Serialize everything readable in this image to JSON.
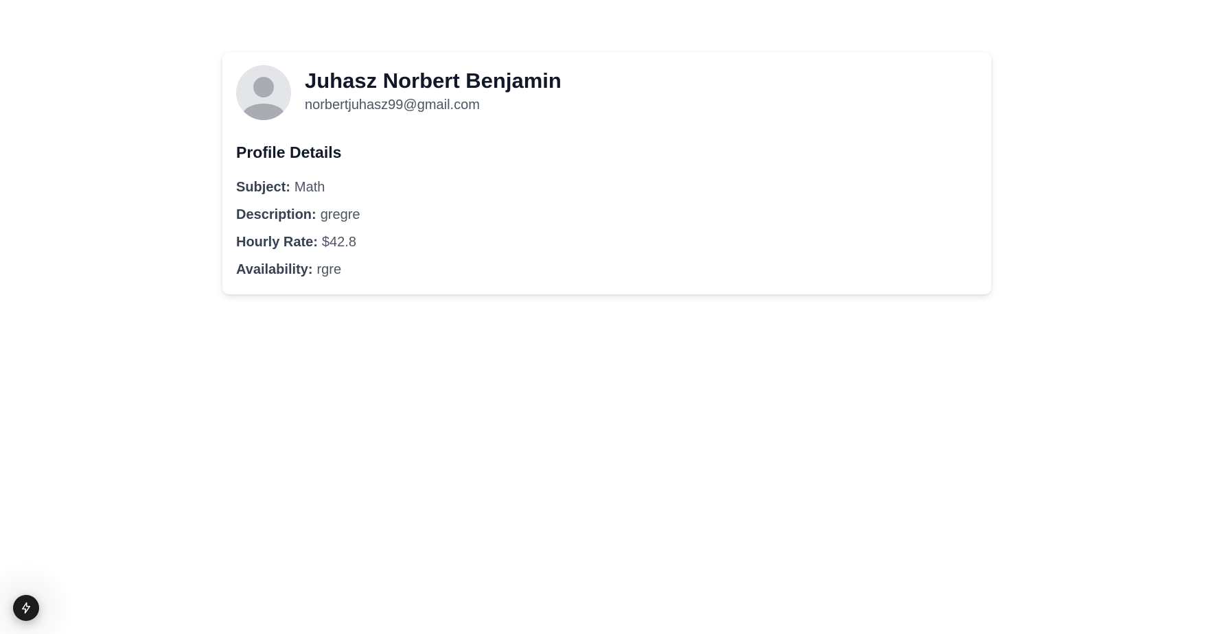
{
  "profile": {
    "name": "Juhasz Norbert Benjamin",
    "email": "norbertjuhasz99@gmail.com",
    "avatar_icon": "user-avatar-placeholder-icon"
  },
  "details": {
    "title": "Profile Details",
    "rows": [
      {
        "label": "Subject:",
        "value": "Math"
      },
      {
        "label": "Description:",
        "value": "gregre"
      },
      {
        "label": "Hourly Rate:",
        "value": "$42.8"
      },
      {
        "label": "Availability:",
        "value": "rgre"
      }
    ]
  },
  "dev_tools": {
    "icon": "lightning-bolt-icon"
  },
  "colors": {
    "background": "#ffffff",
    "heading": "#111827",
    "text": "#374151",
    "muted": "#4b5563",
    "avatar_bg": "#e3e5e8",
    "avatar_figure": "#a9adb3",
    "dev_button": "#1c1c1e"
  }
}
